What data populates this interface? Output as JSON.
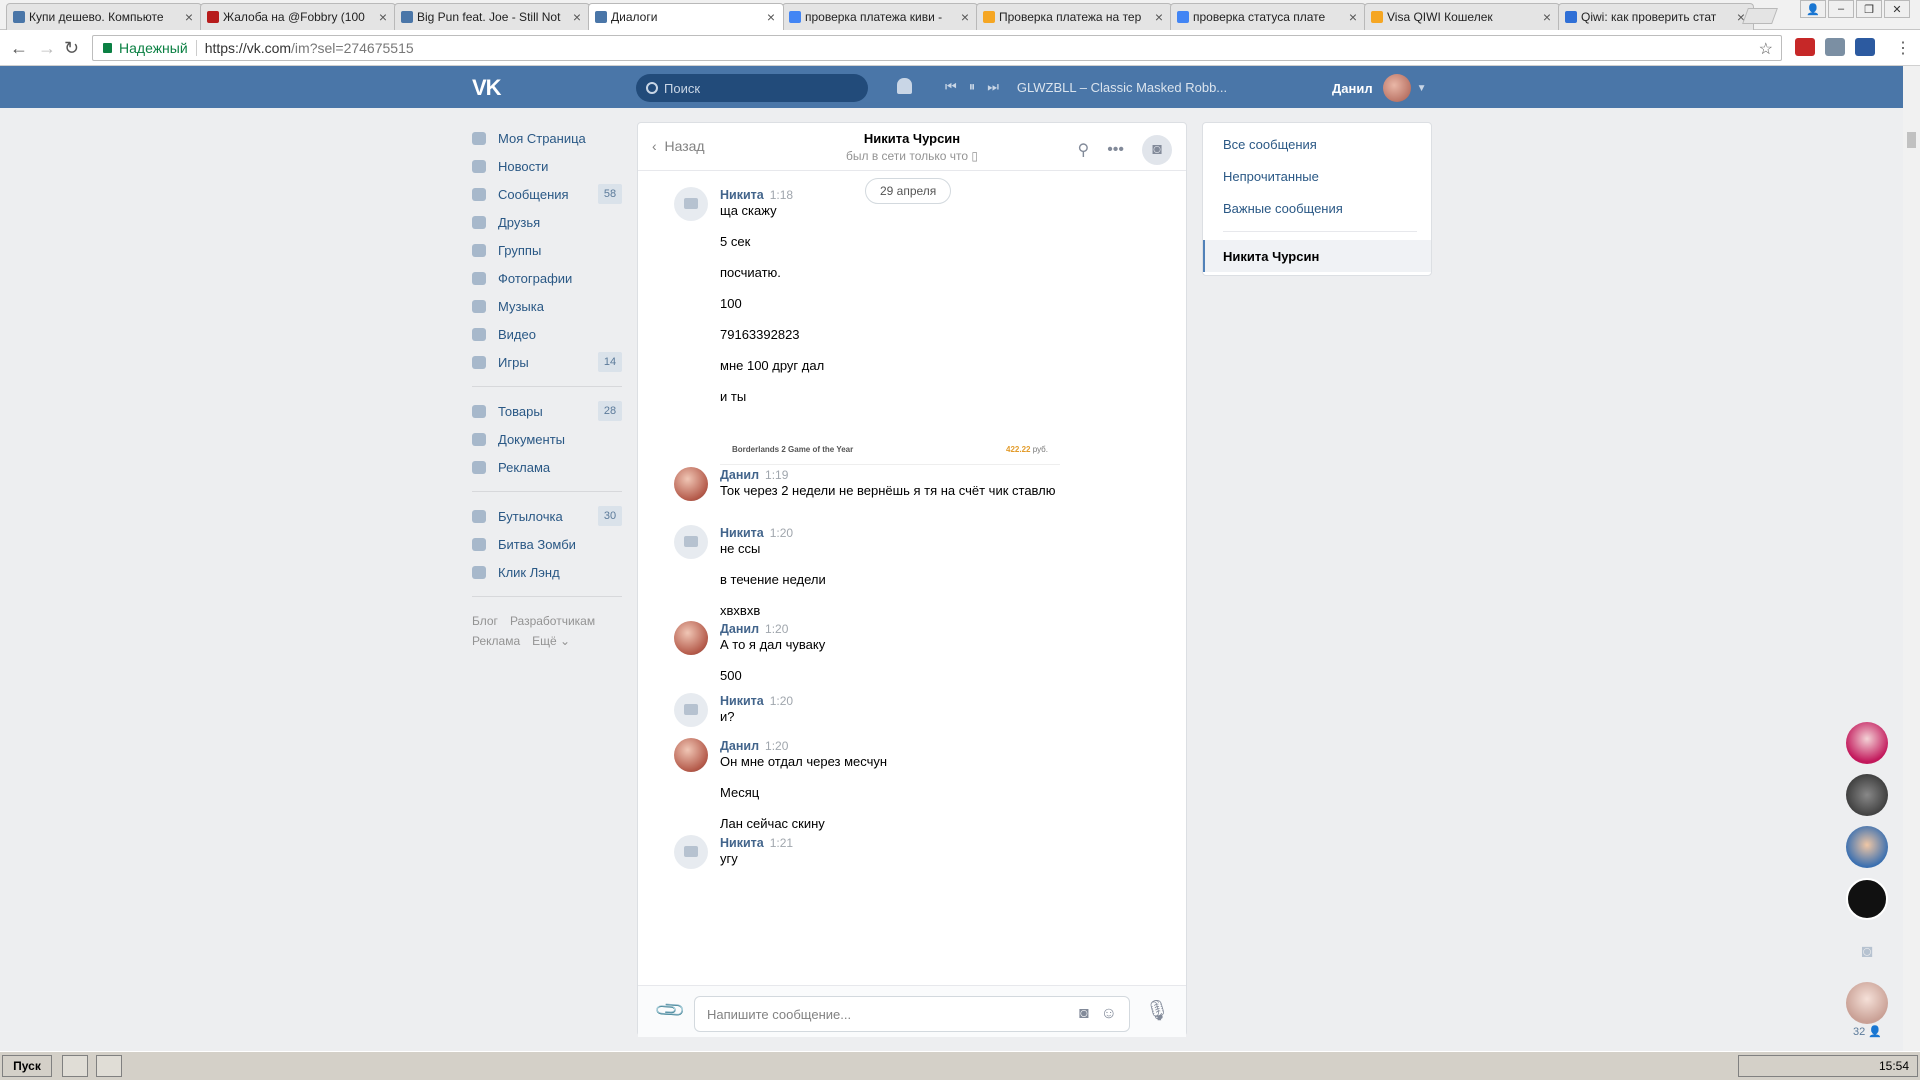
{
  "browser": {
    "tabs": [
      {
        "label": "Купи дешево. Компьюте",
        "favicon_color": "#4a76a8",
        "active": false
      },
      {
        "label": "Жалоба на @Fobbry (100",
        "favicon_color": "#b71c1c",
        "active": false
      },
      {
        "label": "Big Pun feat. Joe - Still Not",
        "favicon_color": "#4a76a8",
        "active": false
      },
      {
        "label": "Диалоги",
        "favicon_color": "#4a76a8",
        "active": true
      },
      {
        "label": "проверка платежа киви -",
        "favicon_color": "#4285f4",
        "active": false
      },
      {
        "label": "Проверка платежа на тер",
        "favicon_color": "#f5a623",
        "active": false
      },
      {
        "label": "проверка статуса плате",
        "favicon_color": "#4285f4",
        "active": false
      },
      {
        "label": "Visa QIWI Кошелек",
        "favicon_color": "#f5a623",
        "active": false
      },
      {
        "label": "Qiwi: как проверить стат",
        "favicon_color": "#2f6fd6",
        "active": false
      }
    ],
    "secure_label": "Надежный",
    "url_host": "https://vk.com",
    "url_path": "/im?sel=274675515"
  },
  "vk_header": {
    "logo": "VK",
    "search_placeholder": "Поиск",
    "track": "GLWZBLL – Classic Masked Robb...",
    "user_name": "Данил"
  },
  "left_nav": {
    "items": [
      {
        "label": "Моя Страница",
        "icon": "home-icon"
      },
      {
        "label": "Новости",
        "icon": "news-icon"
      },
      {
        "label": "Сообщения",
        "icon": "messages-icon",
        "badge": "58"
      },
      {
        "label": "Друзья",
        "icon": "friends-icon"
      },
      {
        "label": "Группы",
        "icon": "groups-icon"
      },
      {
        "label": "Фотографии",
        "icon": "photos-icon"
      },
      {
        "label": "Музыка",
        "icon": "music-icon"
      },
      {
        "label": "Видео",
        "icon": "video-icon"
      },
      {
        "label": "Игры",
        "icon": "games-icon",
        "badge": "14"
      }
    ],
    "items2": [
      {
        "label": "Товары",
        "icon": "goods-icon",
        "badge": "28"
      },
      {
        "label": "Документы",
        "icon": "documents-icon"
      },
      {
        "label": "Реклама",
        "icon": "ads-icon"
      }
    ],
    "apps": [
      {
        "label": "Бутылочка",
        "icon": "app-icon",
        "badge": "30"
      },
      {
        "label": "Битва Зомби",
        "icon": "app-icon"
      },
      {
        "label": "Клик Лэнд",
        "icon": "app-icon"
      }
    ],
    "footer": {
      "blog": "Блог",
      "devs": "Разработчикам",
      "ads": "Реклама",
      "more": "Ещё ⌄"
    }
  },
  "chat": {
    "back_label": "Назад",
    "title": "Никита Чурсин",
    "subtitle": "был в сети только что",
    "date": "29 апреля",
    "attachment": {
      "title": "Borderlands 2 Game of the Year",
      "price": "422.22",
      "currency": "руб."
    },
    "composer_placeholder": "Напишите сообщение...",
    "messages": [
      {
        "author": "Никита",
        "time": "1:18",
        "avatar": "camera",
        "lines": [
          "ща скажу",
          "5 сек",
          "посчиатю.",
          "100",
          "79163392823",
          "мне 100 друг дал",
          "и ты"
        ]
      },
      {
        "author": "Данил",
        "time": "1:19",
        "avatar": "photo",
        "lines": [
          "Ток через 2 недели не вернёшь я тя на счёт чик ставлю"
        ]
      },
      {
        "author": "Никита",
        "time": "1:20",
        "avatar": "camera",
        "lines": [
          "не ссы",
          "в течение недели",
          "хвхвхв"
        ]
      },
      {
        "author": "Данил",
        "time": "1:20",
        "avatar": "photo",
        "lines": [
          "А то я дал чуваку",
          "500"
        ]
      },
      {
        "author": "Никита",
        "time": "1:20",
        "avatar": "camera",
        "lines": [
          "и?"
        ]
      },
      {
        "author": "Данил",
        "time": "1:20",
        "avatar": "photo",
        "lines": [
          "Он мне отдал через месчун",
          "Месяц",
          "Лан сейчас скину"
        ]
      },
      {
        "author": "Никита",
        "time": "1:21",
        "avatar": "camera",
        "lines": [
          "угу"
        ]
      }
    ]
  },
  "filter_panel": {
    "all": "Все сообщения",
    "unread": "Непрочитанные",
    "important": "Важные сообщения",
    "active_dialog": "Никита Чурсин"
  },
  "right_rail": {
    "online_count": "32"
  },
  "taskbar": {
    "start": "Пуск",
    "clock": "15:54"
  }
}
